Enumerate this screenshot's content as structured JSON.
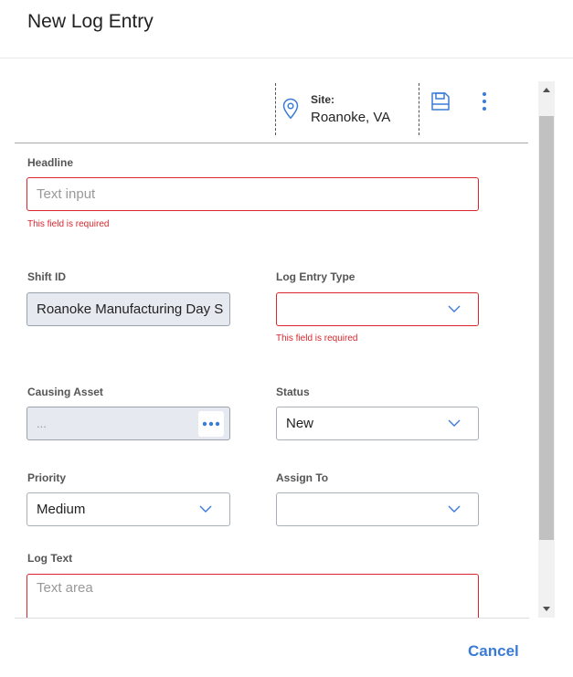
{
  "dialog": {
    "title": "New Log Entry"
  },
  "toolbar": {
    "site_label": "Site:",
    "site_value": "Roanoke, VA",
    "pin_icon": "map-pin-icon",
    "save_icon": "save-icon",
    "more_icon": "more-vertical-icon"
  },
  "form": {
    "headline": {
      "label": "Headline",
      "placeholder": "Text input",
      "error": "This field is required"
    },
    "shift_id": {
      "label": "Shift ID",
      "value": "Roanoke Manufacturing Day S"
    },
    "log_entry_type": {
      "label": "Log Entry Type",
      "value": "",
      "error": "This field is required"
    },
    "causing_asset": {
      "label": "Causing Asset",
      "value": "..."
    },
    "status": {
      "label": "Status",
      "value": "New"
    },
    "priority": {
      "label": "Priority",
      "value": "Medium"
    },
    "assign_to": {
      "label": "Assign To",
      "value": ""
    },
    "log_text": {
      "label": "Log Text",
      "placeholder": "Text area"
    }
  },
  "footer": {
    "cancel_label": "Cancel"
  },
  "colors": {
    "accent": "#3a7bd5",
    "error": "#d9262c",
    "readonly_bg": "#e6e9ef"
  }
}
